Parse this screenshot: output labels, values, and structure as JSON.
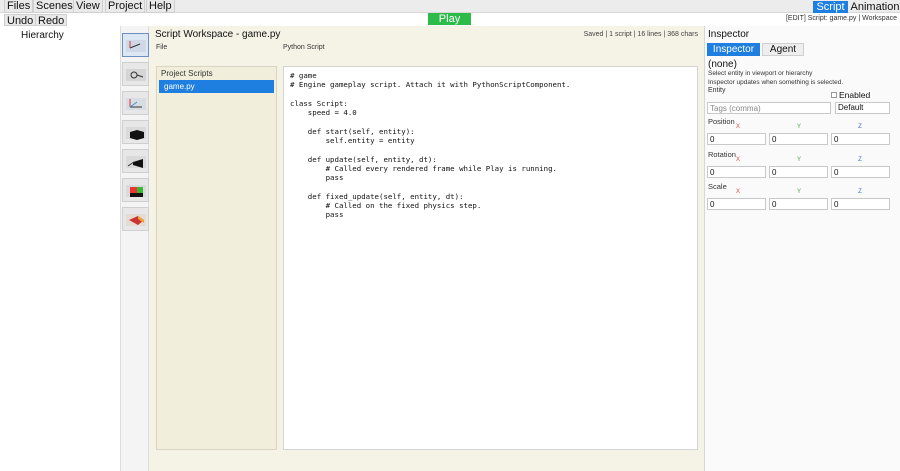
{
  "menu": {
    "files": "Files",
    "scenes": "Scenes",
    "view": "View",
    "project": "Project",
    "help": "Help"
  },
  "toolbar": {
    "play": "Play",
    "undo": "Undo",
    "redo": "Redo"
  },
  "modes": {
    "script": "Script",
    "animation": "Animation"
  },
  "status_right": "[EDIT] Script: game.py | Workspace",
  "hierarchy": {
    "title": "Hierarchy"
  },
  "tools": [
    "select-tool-icon",
    "move-tool-icon",
    "axes-tool-icon",
    "cube-icon",
    "light-icon",
    "color-cube-icon",
    "material-icon"
  ],
  "workspace": {
    "title": "Script Workspace - game.py",
    "file_label": "File",
    "lang_label": "Python Script",
    "status": "Saved | 1 script | 16 lines | 368 chars",
    "scripts_title": "Project Scripts",
    "scripts": [
      "game.py"
    ],
    "code": "# game\n# Engine gameplay script. Attach it with PythonScriptComponent.\n\nclass Script:\n    speed = 4.0\n\n    def start(self, entity):\n        self.entity = entity\n\n    def update(self, entity, dt):\n        # Called every rendered frame while Play is running.\n        pass\n\n    def fixed_update(self, entity, dt):\n        # Called on the fixed physics step.\n        pass"
  },
  "inspector": {
    "title": "Inspector",
    "tab_inspector": "Inspector",
    "tab_agent": "Agent",
    "none": "(none)",
    "hint1": "Select entity in viewport or hierarchy",
    "hint2": "Inspector updates when something is selected.",
    "entity_label": "Entity",
    "enabled_label": "Enabled",
    "tags_placeholder": "Tags (comma)",
    "layer_value": "Default",
    "axes": {
      "x": "X",
      "y": "Y",
      "z": "Z"
    },
    "position_label": "Position",
    "position": {
      "x": "0",
      "y": "0",
      "z": "0"
    },
    "rotation_label": "Rotation",
    "rotation": {
      "x": "0",
      "y": "0",
      "z": "0"
    },
    "scale_label": "Scale",
    "scale": {
      "x": "0",
      "y": "0",
      "z": "0"
    }
  }
}
